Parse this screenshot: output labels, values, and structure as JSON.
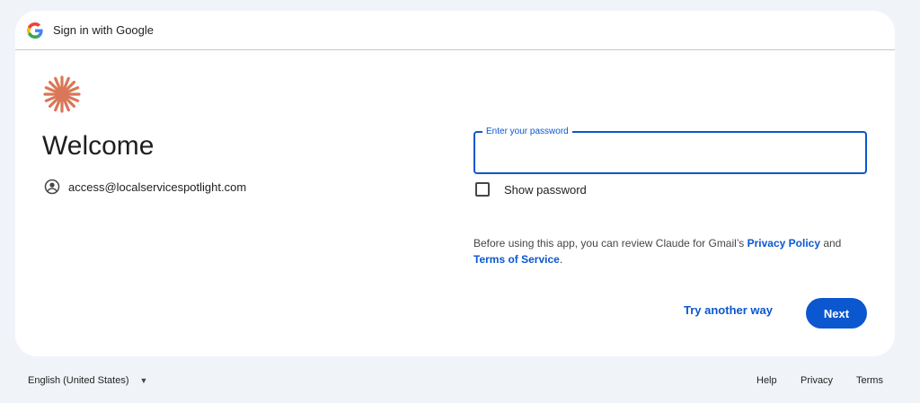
{
  "header": {
    "title": "Sign in with Google"
  },
  "main": {
    "welcome": "Welcome",
    "account_email": "access@localservicespotlight.com"
  },
  "password": {
    "label": "Enter your password",
    "value": "",
    "show_password_label": "Show password"
  },
  "terms": {
    "prefix": "Before using this app, you can review Claude for Gmail’s ",
    "privacy_link": "Privacy Policy",
    "middle": " and",
    "tos_link": "Terms of Service",
    "suffix": "."
  },
  "actions": {
    "try_another": "Try another way",
    "next": "Next"
  },
  "footer": {
    "language": "English (United States)",
    "help": "Help",
    "privacy": "Privacy",
    "terms": "Terms"
  },
  "colors": {
    "accent": "#0b57d0",
    "brand": "#d97757",
    "background": "#f0f4f9"
  },
  "icons": {
    "google": "google-g-icon",
    "brand": "starburst-logo-icon",
    "account": "account-circle-icon",
    "dropdown": "caret-down-icon"
  }
}
